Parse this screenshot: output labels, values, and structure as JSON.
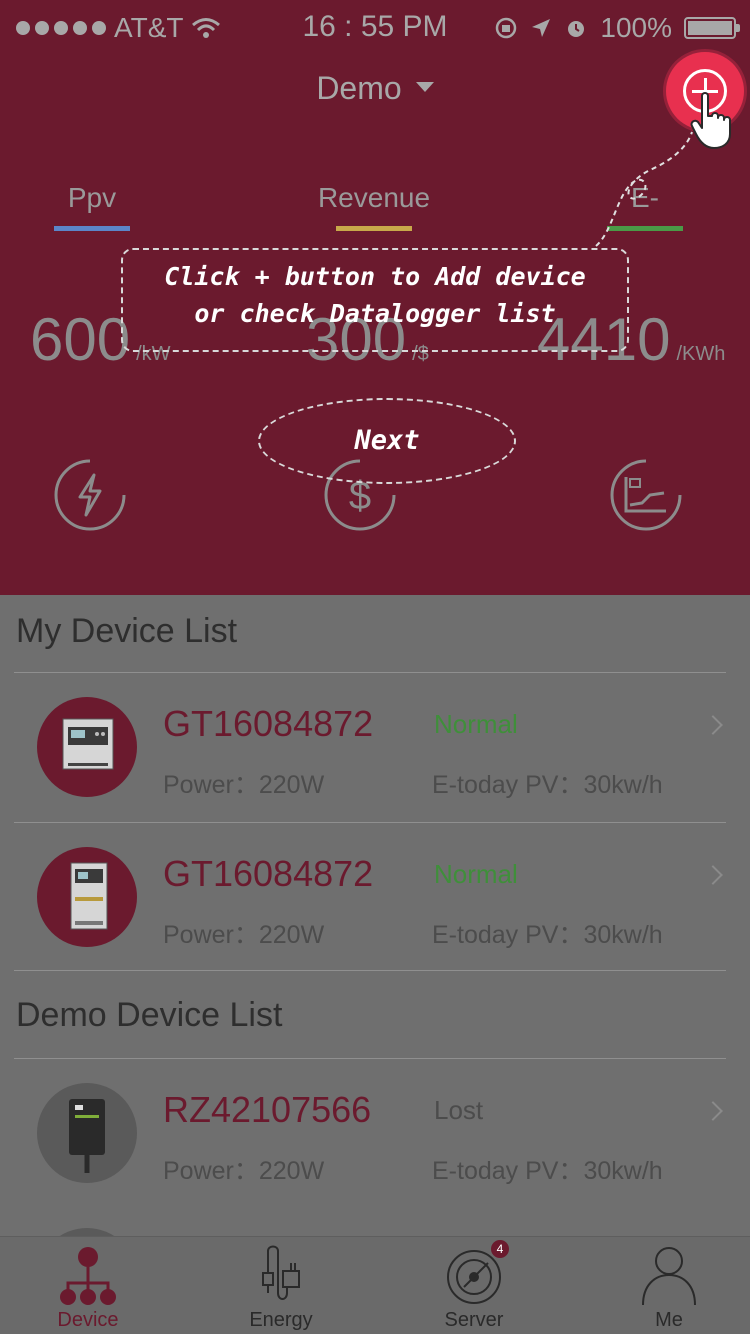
{
  "status_bar": {
    "carrier": "AT&T",
    "time": "16 : 55 PM",
    "battery": "100%"
  },
  "header": {
    "title": "Demo",
    "tabs": [
      {
        "label": "Ppv",
        "color": "#5b86c9"
      },
      {
        "label": "Revenue",
        "color": "#c8a94a"
      },
      {
        "label": "E-",
        "color": "#4a9a47"
      }
    ],
    "stats": [
      {
        "value": "600",
        "unit": "/kW"
      },
      {
        "value": "300",
        "unit": "/$"
      },
      {
        "value": "4410",
        "unit": "/KWh"
      }
    ],
    "icons": [
      "lightning-icon",
      "dollar-icon",
      "chart-icon"
    ]
  },
  "tooltip": {
    "line1": "Click + button to Add device",
    "line2": "or check Datalogger list",
    "next_label": "Next"
  },
  "my_devices": {
    "title": "My Device List",
    "items": [
      {
        "name": "GT16084872",
        "status": "Normal",
        "status_color": "#3f8f3a",
        "power": "Power：220W",
        "etoday": "E-today PV：30kw/h"
      },
      {
        "name": "GT16084872",
        "status": "Normal",
        "status_color": "#3f8f3a",
        "power": "Power：220W",
        "etoday": "E-today PV：30kw/h"
      }
    ]
  },
  "demo_devices": {
    "title": "Demo Device List",
    "items": [
      {
        "name": "RZ42107566",
        "status": "Lost",
        "status_color": "#4c4c4c",
        "power": "Power：220W",
        "etoday": "E-today PV：30kw/h"
      }
    ]
  },
  "nav": {
    "items": [
      {
        "label": "Device"
      },
      {
        "label": "Energy"
      },
      {
        "label": "Server",
        "badge": "4"
      },
      {
        "label": "Me"
      }
    ]
  }
}
